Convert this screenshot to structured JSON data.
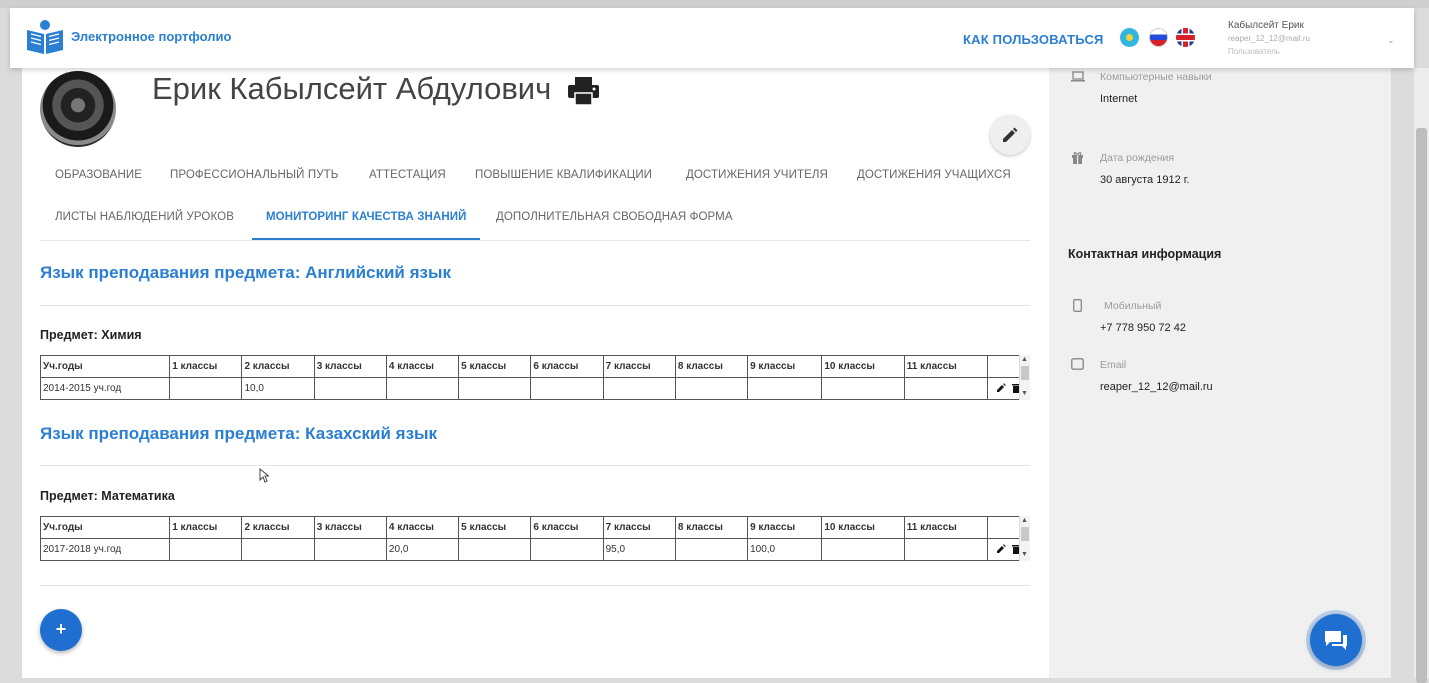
{
  "header": {
    "brand": "Электронное портфолио",
    "how_to": "КАК ПОЛЬЗОВАТЬСЯ",
    "languages": [
      "kz-flag-icon",
      "ru-flag-icon",
      "gb-flag-icon"
    ],
    "user": {
      "name": "Кабылсейт Ерик",
      "email": "reaper_12_12@mail.ru",
      "role": "Пользователь"
    }
  },
  "profile": {
    "full_name": "Ерик Кабылсейт Абдулович"
  },
  "tabs": [
    {
      "label": "ОБРАЗОВАНИЕ",
      "active": false
    },
    {
      "label": "ПРОФЕССИОНАЛЬНЫЙ ПУТЬ",
      "active": false
    },
    {
      "label": "АТТЕСТАЦИЯ",
      "active": false
    },
    {
      "label": "ПОВЫШЕНИЕ КВАЛИФИКАЦИИ",
      "active": false
    },
    {
      "label": "ДОСТИЖЕНИЯ УЧИТЕЛЯ",
      "active": false
    },
    {
      "label": "ДОСТИЖЕНИЯ УЧАЩИХСЯ",
      "active": false
    },
    {
      "label": "ЛИСТЫ НАБЛЮДЕНИЙ УРОКОВ",
      "active": false
    },
    {
      "label": "МОНИТОРИНГ КАЧЕСТВА ЗНАНИЙ",
      "active": true
    },
    {
      "label": "ДОПОЛНИТЕЛЬНАЯ СВОБОДНАЯ ФОРМА",
      "active": false
    }
  ],
  "table_headers": [
    "Уч.годы",
    "1 классы",
    "2 классы",
    "3 классы",
    "4 классы",
    "5 классы",
    "6 классы",
    "7 классы",
    "8 классы",
    "9 классы",
    "10 классы",
    "11 классы"
  ],
  "sections": [
    {
      "title": "Язык преподавания предмета: Английский язык",
      "subject": "Предмет: Химия",
      "rows": [
        [
          "2014-2015 уч.год",
          "",
          "10,0",
          "",
          "",
          "",
          "",
          "",
          "",
          "",
          "",
          ""
        ]
      ]
    },
    {
      "title": "Язык преподавания предмета: Казахский язык",
      "subject": "Предмет: Математика",
      "rows": [
        [
          "2017-2018 уч.год",
          "",
          "",
          "",
          "20,0",
          "",
          "",
          "95,0",
          "",
          "100,0",
          "",
          ""
        ]
      ]
    }
  ],
  "sidebar": {
    "skills_label": "Компьютерные навыки",
    "skills_value": "Internet",
    "birth_label": "Дата рождения",
    "birth_value": "30 августа 1912 г.",
    "contact_heading": "Контактная информация",
    "mobile_label": "Мобильный",
    "mobile_value": "+7 778 950 72 42",
    "email_label": "Email",
    "email_value": "reaper_12_12@mail.ru"
  },
  "colors": {
    "accent": "#2b7fd2",
    "fab": "#1e6fd0"
  }
}
